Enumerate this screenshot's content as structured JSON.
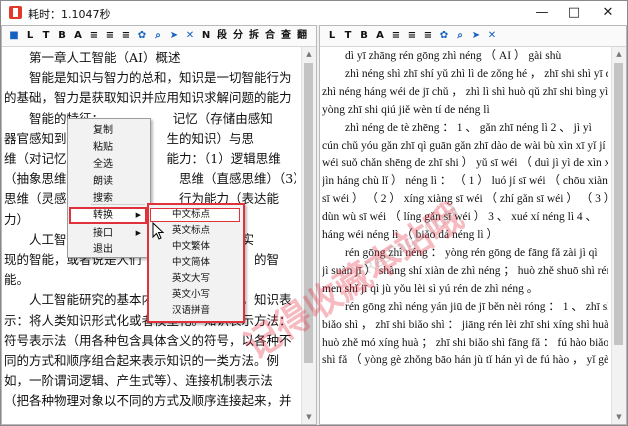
{
  "window": {
    "title": "耗时：1.1047秒",
    "buttons": [
      "minimize",
      "maximize",
      "close"
    ]
  },
  "toolbar_left": {
    "items": [
      {
        "name": "stop-icon",
        "glyph": "■"
      },
      {
        "name": "letter-l",
        "glyph": "L"
      },
      {
        "name": "letter-t",
        "glyph": "T"
      },
      {
        "name": "bold-b",
        "glyph": "B"
      },
      {
        "name": "font-a-icon",
        "glyph": "A"
      },
      {
        "name": "align-left-icon",
        "glyph": "≡"
      },
      {
        "name": "align-center-icon",
        "glyph": "≡"
      },
      {
        "name": "align-justify-icon",
        "glyph": "≡"
      },
      {
        "name": "palette-icon",
        "glyph": "✿"
      },
      {
        "name": "search-icon",
        "glyph": "⌕"
      },
      {
        "name": "send-icon",
        "glyph": "➤"
      },
      {
        "name": "clear-icon",
        "glyph": "✕"
      },
      {
        "name": "letter-n",
        "glyph": "N"
      },
      {
        "name": "segment",
        "glyph": "段"
      },
      {
        "name": "split",
        "glyph": "分"
      },
      {
        "name": "merge",
        "glyph": "拆"
      },
      {
        "name": "combine",
        "glyph": "合"
      },
      {
        "name": "check",
        "glyph": "查"
      },
      {
        "name": "translate",
        "glyph": "翻"
      }
    ]
  },
  "toolbar_right": {
    "items": [
      {
        "name": "letter-l",
        "glyph": "L"
      },
      {
        "name": "letter-t",
        "glyph": "T"
      },
      {
        "name": "bold-b",
        "glyph": "B"
      },
      {
        "name": "font-a-icon",
        "glyph": "A"
      },
      {
        "name": "align-left-icon",
        "glyph": "≡"
      },
      {
        "name": "align-center-icon",
        "glyph": "≡"
      },
      {
        "name": "align-justify-icon",
        "glyph": "≡"
      },
      {
        "name": "palette-icon",
        "glyph": "✿"
      },
      {
        "name": "search-icon",
        "glyph": "⌕"
      },
      {
        "name": "send-icon",
        "glyph": "➤"
      },
      {
        "name": "clear-icon",
        "glyph": "✕"
      }
    ]
  },
  "left_text": [
    "　　第一章人工智能（AI）概述",
    "　　智能是知识与智力的总和，知识是一切智能行为",
    "的基础，智力是获取知识并应用知识求解问题的能力",
    "　　智能的特征：　　　　　　记忆（存储由感知",
    "器官感知到　　　　　　　　生的知识）与思",
    "维（对记忆　　　　　　　　能力：（1）逻辑思维",
    "（抽象思维　　　　　　　　　思维（直感思维）（3）顿悟",
    "思维（灵感　　　　　　　　　行为能力（表达能",
    "力）",
    "　　人工智　　　　　　　　　　　　）上实",
    "现的智能，或者说是人们　　　　　　　　　的智",
    "能。",
    "　　人工智能研究的基本内　　　　　　　，知识表",
    "示：将人类知识形式化或者模型化。知识表示方法：",
    "符号表示法（用各种包含具体含义的符号，以各种不",
    "同的方式和顺序组合起来表示知识的一类方法。例",
    "如，一阶谓词逻辑、产生式等）、连接机制表示法",
    "（把各种物理对象以不同的方式及顺序连接起来，并"
  ],
  "right_text": [
    "　　dì yī zhāng rén gōng zhì néng （ AI ） gài shù",
    "　　zhì néng shì zhī shí yǔ zhì lì de zǒng hé ，  zhī shi shì yī qiē",
    "zhì néng háng wéi de jī chǔ ，  zhì lì shì huò qǔ zhī shi bìng yìng",
    "yòng zhī shi qiú jiě wèn tí de néng lì",
    "　　zhì néng de tè zhēng ： 1 、 gǎn zhī néng lì 2 、 jì yì",
    "cún chǔ yóu gǎn zhī qì guān gǎn zhī dào de wài bù xìn xī yǐ jí sī",
    "wéi suǒ chǎn shēng de zhī shi ）  yǔ sī wéi （ duì jì yì de xìn xī",
    "jìn háng chù lǐ ） néng lì ： （ 1 ） luó jí sī wéi （ chōu xiàng",
    "sī wéi ） （ 2 ） xíng xiàng sī wéi （ zhí gǎn sī wéi ）  （ 3 ）",
    "dùn wù sī wéi （ líng gǎn sī wéi ） 3 、 xué xí néng lì 4 、",
    "háng wéi néng lì （ biǎo dá néng lì ）",
    "　　rén gōng zhì néng ： yòng rén gōng de fāng fǎ zài jì qì （",
    "jì suàn jī ） shàng shí xiàn de zhì néng ；  huò zhě shuō shì rén",
    "men shǐ jī qì jù yǒu lèi sì yú rén de zhì néng 。",
    "　　rén gōng zhì néng yán jiū de jī běn nèi róng ： 1 、 zhī shi",
    "biǎo shì ，  zhī shi biǎo shì ： jiāng rén lèi zhī shi xíng shì huà",
    "huò zhě mó xíng huà ；  zhī shi biǎo shì fāng fǎ ： fú hào biǎo",
    "shì fǎ （ yòng gè zhǒng bāo hán jù tǐ hán yì de fú hào ，  yǐ gè"
  ],
  "context_menu": {
    "items": [
      {
        "label": "复制",
        "submenu": false
      },
      {
        "label": "粘贴",
        "submenu": false
      },
      {
        "label": "全选",
        "submenu": false
      },
      {
        "label": "朗读",
        "submenu": false
      },
      {
        "label": "搜索",
        "submenu": false
      },
      {
        "label": "转换",
        "submenu": true,
        "active": true
      },
      {
        "label": "接口",
        "submenu": true
      },
      {
        "label": "退出",
        "submenu": false
      }
    ]
  },
  "submenu": {
    "items": [
      {
        "label": "中文标点",
        "active": true
      },
      {
        "label": "英文标点"
      },
      {
        "label": "中文繁体"
      },
      {
        "label": "中文简体"
      },
      {
        "label": "英文大写"
      },
      {
        "label": "英文小写"
      },
      {
        "label": "汉语拼音"
      }
    ]
  },
  "watermark": {
    "text": "记得收藏本站哦",
    "site": "ResPage.COM"
  },
  "colors": {
    "highlight": "#e0323a",
    "blue_icon": "#1560c0"
  }
}
